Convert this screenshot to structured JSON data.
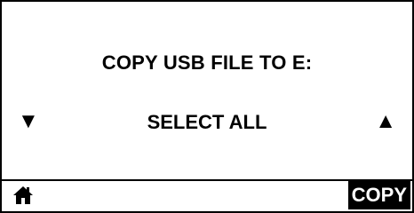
{
  "screen": {
    "prompt": "COPY USB FILE TO E:",
    "option": "SELECT ALL",
    "scroll_down_icon": "▼",
    "scroll_up_icon": "▲"
  },
  "softkeys": {
    "left_icon": "home-icon",
    "right_label": "COPY"
  },
  "colors": {
    "foreground": "#000000",
    "background": "#ffffff"
  }
}
